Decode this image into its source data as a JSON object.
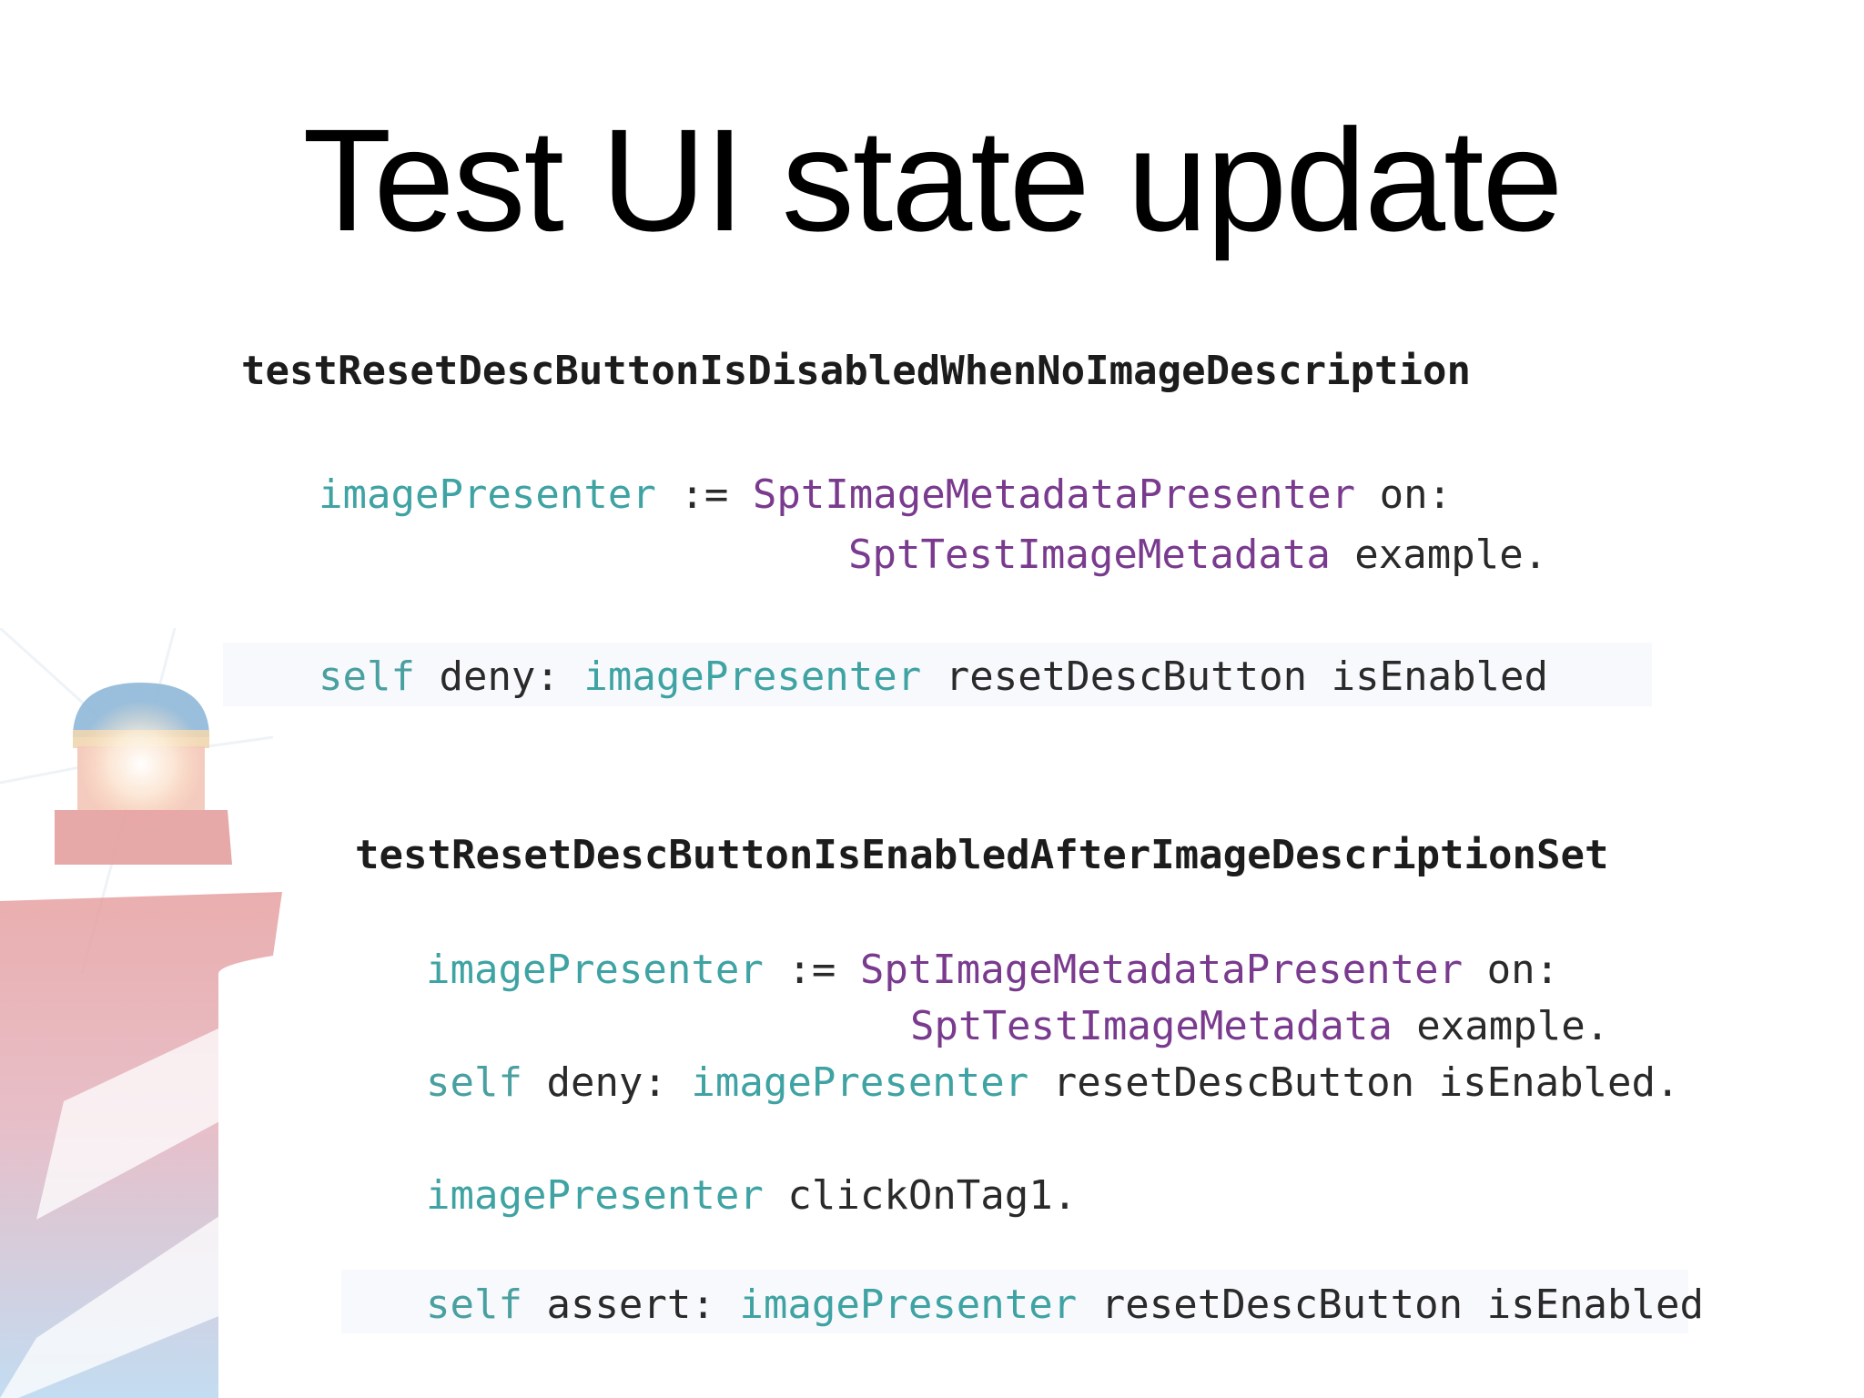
{
  "slide": {
    "title": "Test UI state update"
  },
  "code_block_1": {
    "method": "testResetDescButtonIsDisabledWhenNoImageDescription",
    "line1": {
      "var": "imagePresenter",
      "op": " := ",
      "cls": "SptImageMetadataPresenter",
      "msg": " on:"
    },
    "line2": {
      "cls": "SptTestImageMetadata",
      "msg": " example."
    },
    "line3": {
      "kw": "self",
      "msg1": " deny: ",
      "var": "imagePresenter",
      "msg2": " resetDescButton isEnabled"
    }
  },
  "code_block_2": {
    "method": "testResetDescButtonIsEnabledAfterImageDescriptionSet",
    "line1": {
      "var": "imagePresenter",
      "op": " := ",
      "cls": "SptImageMetadataPresenter",
      "msg": " on:"
    },
    "line2": {
      "cls": "SptTestImageMetadata",
      "msg": " example."
    },
    "line3": {
      "kw": "self",
      "msg1": " deny: ",
      "var": "imagePresenter",
      "msg2": " resetDescButton isEnabled."
    },
    "line4": {
      "var": "imagePresenter",
      "msg": " clickOnTag1."
    },
    "line5": {
      "kw": "self",
      "msg1": " assert: ",
      "var": "imagePresenter",
      "msg2": " resetDescButton isEnabled"
    }
  }
}
